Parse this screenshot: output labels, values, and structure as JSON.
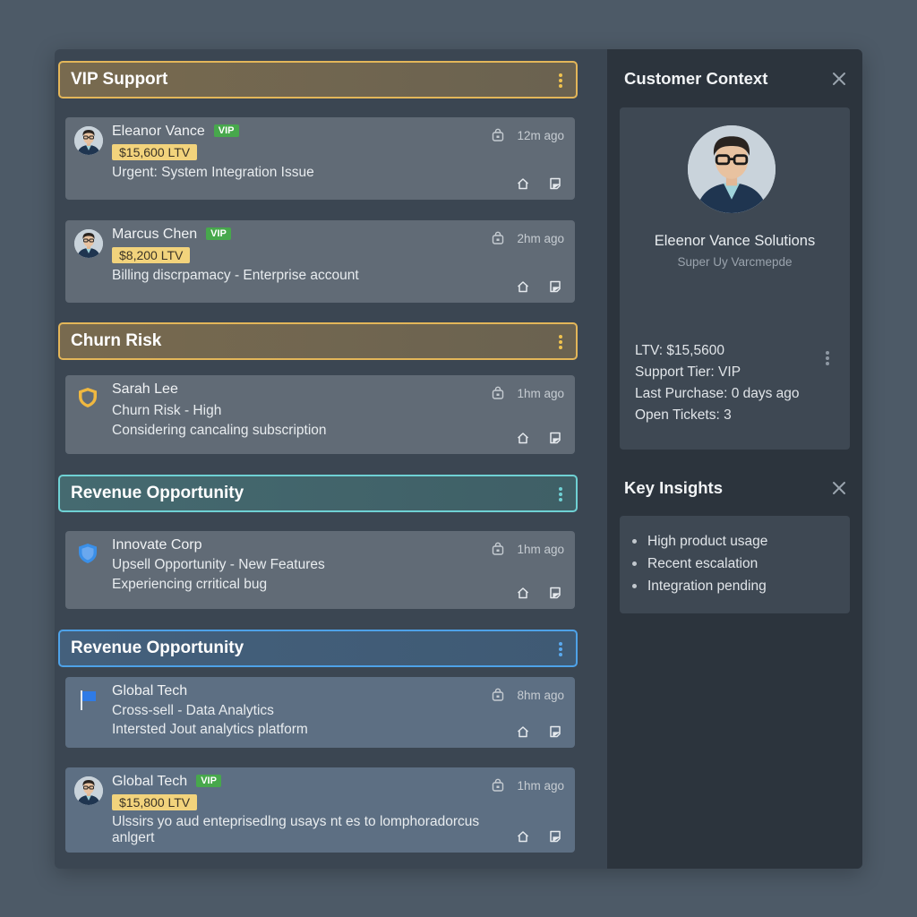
{
  "groups": [
    {
      "title": "VIP Support",
      "cards": [
        {
          "name": "Eleanor Vance",
          "vip": "VIP",
          "ltv": "$15,600 LTV",
          "line1": "Urgent: System Integration Issue",
          "time": "12m ago",
          "leading_icon": "avatar"
        },
        {
          "name": "Marcus Chen",
          "vip": "VIP",
          "ltv": "$8,200 LTV",
          "line1": "Billing discrpamacy - Enterprise account",
          "time": "2hm ago",
          "leading_icon": "avatar"
        }
      ]
    },
    {
      "title": "Churn Risk",
      "cards": [
        {
          "name": "Sarah Lee",
          "line1": "Churn Risk - High",
          "line2": "Considering cancaling subscription",
          "time": "1hm ago",
          "leading_icon": "shield-icon"
        }
      ]
    },
    {
      "title": "Revenue Opportunity",
      "cards": [
        {
          "name": "Innovate Corp",
          "line1": "Upsell Opportunity - New Features",
          "line2": "Experiencing crritical bug",
          "time": "1hm ago",
          "leading_icon": "shield-icon"
        }
      ]
    },
    {
      "title": "Revenue Opportunity",
      "cards": [
        {
          "name": "Global Tech",
          "line1": "Cross-sell - Data Analytics",
          "line2": "Intersted Jout analytics platform",
          "time": "8hm ago",
          "leading_icon": "flag-icon"
        },
        {
          "name": "Global Tech",
          "vip": "VIP",
          "ltv": "$15,800 LTV",
          "line1": "Ulssirs yo aud enteprisedlng usays nt es to lomphoradorcus",
          "line2": "anlgert",
          "time": "1hm ago",
          "leading_icon": "avatar"
        }
      ]
    }
  ],
  "context": {
    "title": "Customer Context",
    "company": "Eleenor Vance Solutions",
    "subtitle": "Super Uy Varcmepde",
    "stats": [
      "LTV: $15,5600",
      "Support Tier: VIP",
      "Last Purchase: 0 days ago",
      "Open Tickets: 3"
    ]
  },
  "insights": {
    "title": "Key Insights",
    "items": [
      "High product usage",
      "Recent escalation",
      "Integration pending"
    ]
  },
  "colors": {
    "accent_gold": "#e3b659",
    "accent_teal": "#6fd1d4",
    "accent_blue": "#4ea2e8",
    "vip_green": "#47a84c",
    "ltv_yellow": "#f2d37c"
  }
}
